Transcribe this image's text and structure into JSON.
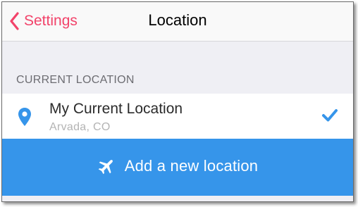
{
  "navbar": {
    "back_label": "Settings",
    "title": "Location"
  },
  "section": {
    "header": "CURRENT LOCATION"
  },
  "current_location": {
    "title": "My Current Location",
    "subtitle": "Arvada, CO",
    "selected": true
  },
  "add_location": {
    "label": "Add a new location"
  },
  "icons": {
    "back": "chevron-left-icon",
    "location": "location-pin-icon",
    "selected": "checkmark-icon",
    "add": "airplane-icon"
  },
  "colors": {
    "accent_pink": "#f2436a",
    "accent_blue": "#3695ea",
    "background": "#efeff4"
  }
}
